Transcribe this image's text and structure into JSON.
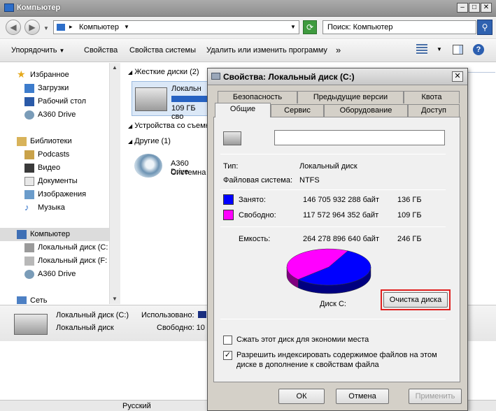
{
  "explorer": {
    "title": "Компьютер",
    "address": "Компьютер",
    "search_placeholder": "Поиск: Компьютер",
    "toolbar": {
      "organize": "Упорядочить",
      "properties": "Свойства",
      "system_properties": "Свойства системы",
      "uninstall": "Удалить или изменить программу",
      "more": "»"
    },
    "nav": {
      "favorites": "Избранное",
      "downloads": "Загрузки",
      "desktop": "Рабочий стол",
      "a360_fav": "A360 Drive",
      "libraries": "Библиотеки",
      "podcasts": "Podcasts",
      "video": "Видео",
      "documents": "Документы",
      "images": "Изображения",
      "music": "Музыка",
      "computer": "Компьютер",
      "local_c": "Локальный диск (C:",
      "local_f": "Локальный диск (F:",
      "a360": "A360 Drive",
      "network": "Сеть"
    },
    "main": {
      "hdd_group": "Жесткие диски (2)",
      "hdd_item_name": "Локальн",
      "hdd_item_size": "109 ГБ сво",
      "removable_group": "Устройства со съемн",
      "other_group": "Другие (1)",
      "a360_name": "A360 Drive",
      "a360_type": "Системна"
    },
    "details": {
      "name": "Локальный диск (C:)",
      "used_label": "Использовано:",
      "type": "Локальный диск",
      "free_label": "Свободно: 10"
    },
    "status": {
      "lang": "Русский"
    }
  },
  "dialog": {
    "title": "Свойства: Локальный диск (C:)",
    "close": "✕",
    "tabs_back": [
      "Безопасность",
      "Предыдущие версии",
      "Квота"
    ],
    "tabs_front": [
      "Общие",
      "Сервис",
      "Оборудование",
      "Доступ"
    ],
    "name_value": "",
    "type_label": "Тип:",
    "type_value": "Локальный диск",
    "fs_label": "Файловая система:",
    "fs_value": "NTFS",
    "used_label": "Занято:",
    "used_bytes": "146 705 932 288 байт",
    "used_gb": "136 ГБ",
    "free_label": "Свободно:",
    "free_bytes": "117 572 964 352 байт",
    "free_gb": "109 ГБ",
    "capacity_label": "Емкость:",
    "capacity_bytes": "264 278 896 640 байт",
    "capacity_gb": "246 ГБ",
    "disk_label": "Диск C:",
    "cleanup_button": "Очистка диска",
    "compress_label": "Сжать этот диск для экономии места",
    "index_label_1": "Разрешить индексировать содержимое файлов на этом",
    "index_label_2": "диске в дополнение к свойствам файла",
    "ok": "ОК",
    "cancel": "Отмена",
    "apply": "Применить",
    "colors": {
      "used": "#0000ff",
      "free": "#ff00ff"
    }
  },
  "chart_data": {
    "type": "pie",
    "categories": [
      "Занято",
      "Свободно"
    ],
    "values": [
      146705932288,
      117572964352
    ],
    "title": "Диск C:",
    "colors": [
      "#0000ff",
      "#ff00ff"
    ]
  }
}
